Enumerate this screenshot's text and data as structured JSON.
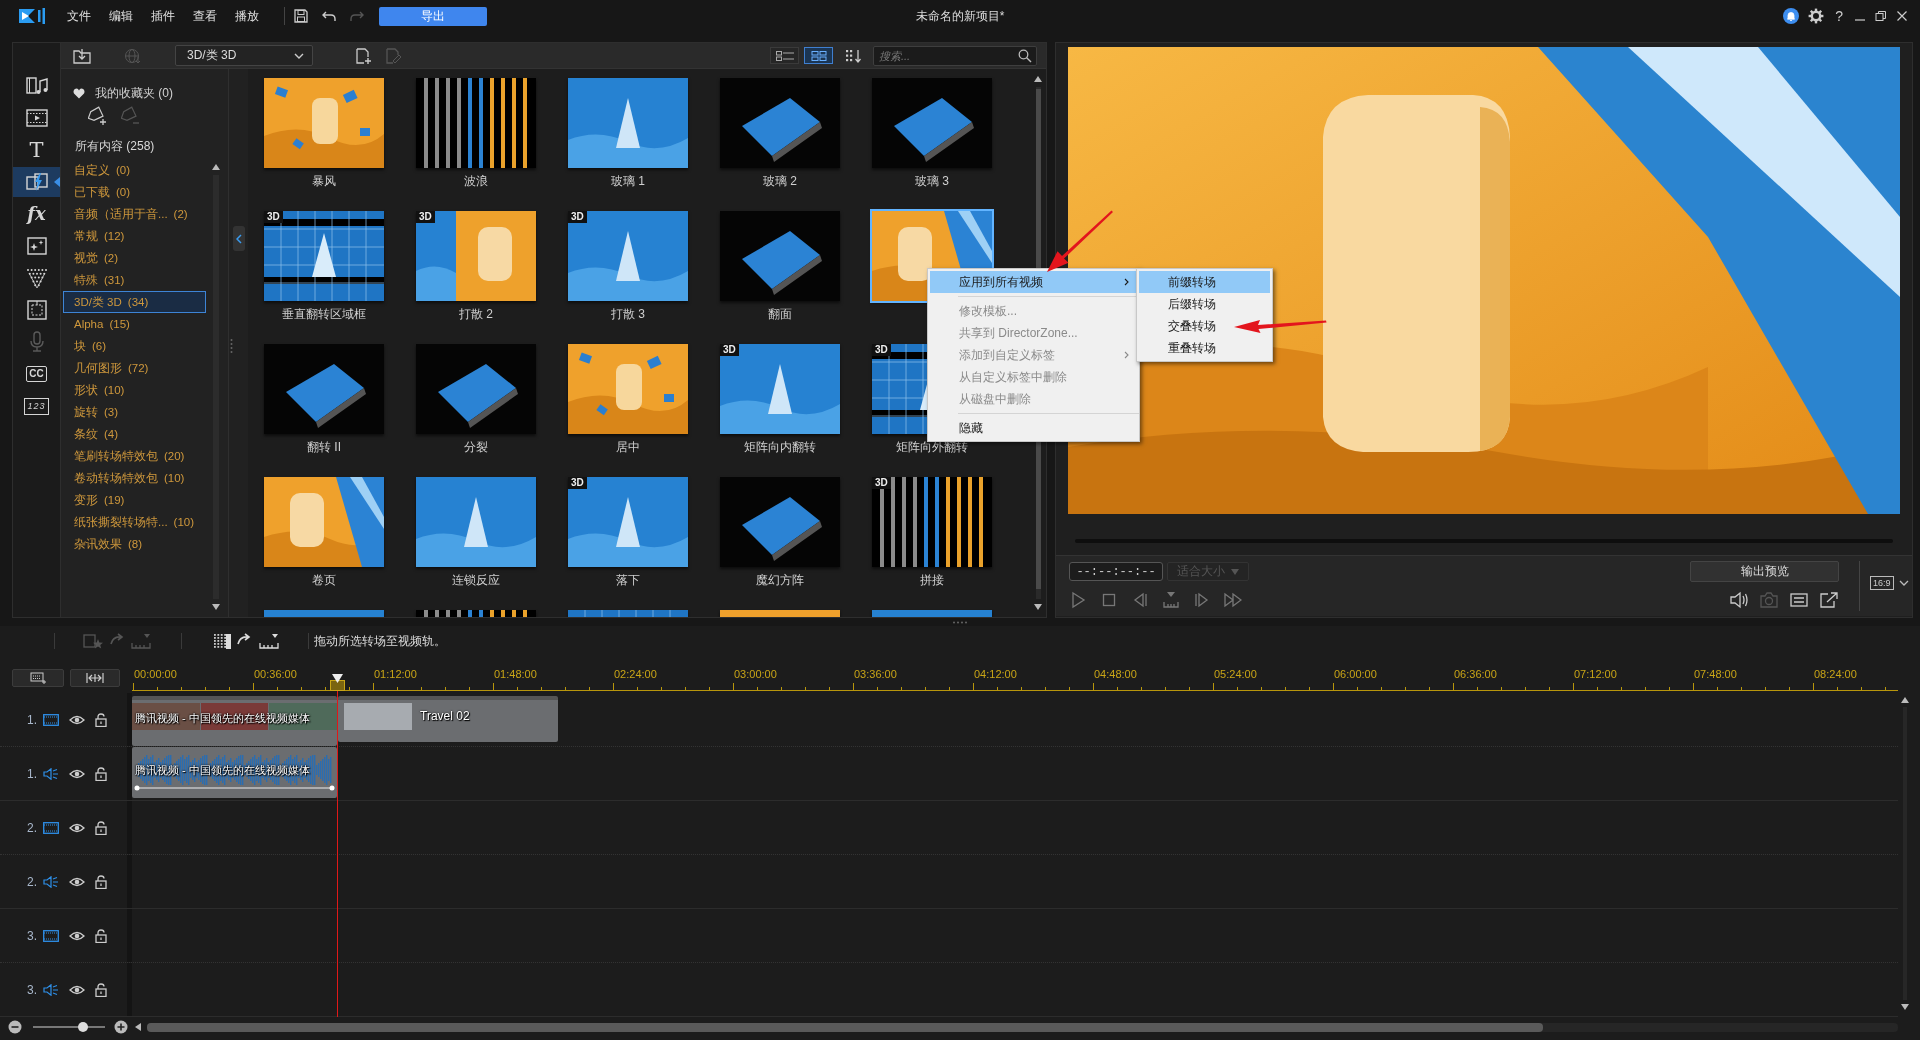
{
  "title_bar": {
    "menus": [
      "文件",
      "编辑",
      "插件",
      "查看",
      "播放"
    ],
    "export_button": "导出",
    "title": "未命名的新项目*",
    "help": "?"
  },
  "side_tools": [
    {
      "kind": "media",
      "selected": false,
      "disabled": false
    },
    {
      "kind": "video",
      "selected": false,
      "disabled": false
    },
    {
      "kind": "title",
      "glyph": "T",
      "selected": false,
      "disabled": false
    },
    {
      "kind": "transition",
      "selected": true,
      "disabled": false
    },
    {
      "kind": "effect",
      "glyph": "fx",
      "selected": false,
      "disabled": false
    },
    {
      "kind": "particle",
      "selected": false,
      "disabled": false
    },
    {
      "kind": "spray",
      "selected": false,
      "disabled": false
    },
    {
      "kind": "chapter",
      "selected": false,
      "disabled": false
    },
    {
      "kind": "voice",
      "selected": false,
      "disabled": true
    },
    {
      "kind": "caption",
      "glyph": "CC",
      "selected": false,
      "disabled": false
    },
    {
      "kind": "counter",
      "glyph": "123",
      "selected": false,
      "disabled": false
    }
  ],
  "library": {
    "category_dropdown": "3D/类 3D",
    "view_modes": [
      {
        "kind": "list",
        "selected": false
      },
      {
        "kind": "grid",
        "selected": true
      }
    ],
    "search": {
      "placeholder": "搜索..."
    },
    "favorites": "我的收藏夹 (0)",
    "all_content": "所有内容 (258)",
    "categories": [
      {
        "name": "自定义",
        "count": "(0)",
        "selected": false
      },
      {
        "name": "已下载",
        "count": "(0)",
        "selected": false
      },
      {
        "name": "音频（适用于音...",
        "count": "(2)",
        "selected": false
      },
      {
        "name": "常规",
        "count": "(12)",
        "selected": false
      },
      {
        "name": "视觉",
        "count": "(2)",
        "selected": false
      },
      {
        "name": "特殊",
        "count": "(31)",
        "selected": false
      },
      {
        "name": "3D/类 3D",
        "count": "(34)",
        "selected": true
      },
      {
        "name": "Alpha",
        "count": "(15)",
        "selected": false
      },
      {
        "name": "块",
        "count": "(6)",
        "selected": false
      },
      {
        "name": "几何图形",
        "count": "(72)",
        "selected": false
      },
      {
        "name": "形状",
        "count": "(10)",
        "selected": false
      },
      {
        "name": "旋转",
        "count": "(3)",
        "selected": false
      },
      {
        "name": "条纹",
        "count": "(4)",
        "selected": false
      },
      {
        "name": "笔刷转场特效包",
        "count": "(20)",
        "selected": false
      },
      {
        "name": "卷动转场特效包",
        "count": "(10)",
        "selected": false
      },
      {
        "name": "变形",
        "count": "(19)",
        "selected": false
      },
      {
        "name": "纸张撕裂转场特...",
        "count": "(10)",
        "selected": false
      },
      {
        "name": "杂讯效果",
        "count": "(8)",
        "selected": false
      }
    ],
    "tile_rows": [
      [
        {
          "label": "暴风",
          "kind": "orange",
          "selected": false
        },
        {
          "label": "波浪",
          "kind": "stripes",
          "selected": false
        },
        {
          "label": "玻璃 1",
          "kind": "blue",
          "selected": false
        },
        {
          "label": "玻璃 2",
          "kind": "dark",
          "selected": false
        },
        {
          "label": "玻璃 3",
          "kind": "dark",
          "selected": false
        }
      ],
      [
        {
          "label": "垂直翻转区域框",
          "kind": "grid",
          "badge": "3D",
          "selected": false
        },
        {
          "label": "打散 2",
          "kind": "split",
          "badge": "3D",
          "selected": false
        },
        {
          "label": "打散 3",
          "kind": "blue",
          "badge": "3D",
          "selected": false
        },
        {
          "label": "翻面",
          "kind": "dark",
          "selected": false
        },
        {
          "kind": "orange_blue",
          "selected": true
        }
      ],
      [
        {
          "label": "翻转 II",
          "kind": "dark",
          "selected": false
        },
        {
          "label": "分裂",
          "kind": "dark",
          "selected": false
        },
        {
          "label": "居中",
          "kind": "orange",
          "selected": false
        },
        {
          "label": "矩阵向内翻转",
          "kind": "blue",
          "badge": "3D",
          "selected": false
        },
        {
          "label": "矩阵向外翻转",
          "kind": "grid",
          "badge": "3D",
          "selected": false
        }
      ],
      [
        {
          "label": "卷页",
          "kind": "orange_blue",
          "selected": false
        },
        {
          "label": "连锁反应",
          "kind": "blue",
          "selected": false
        },
        {
          "label": "落下",
          "kind": "blue",
          "badge": "3D",
          "selected": false
        },
        {
          "label": "魔幻方阵",
          "kind": "dark",
          "selected": false
        },
        {
          "label": "拼接",
          "kind": "stripes",
          "badge": "3D",
          "selected": false
        }
      ],
      [
        {
          "kind": "blue",
          "selected": false
        },
        {
          "kind": "stripes",
          "selected": false
        },
        {
          "kind": "grid",
          "selected": false
        },
        {
          "kind": "orange",
          "selected": false
        },
        {
          "kind": "blue",
          "selected": false
        }
      ]
    ]
  },
  "context_menu": {
    "items": [
      {
        "kind": "item",
        "label": "应用到所有视频",
        "selected": true,
        "disabled": false,
        "has_submenu": true,
        "annotated": true
      },
      {
        "kind": "separator"
      },
      {
        "kind": "item",
        "label": "修改模板...",
        "selected": false,
        "disabled": true,
        "has_submenu": false,
        "annotated": false
      },
      {
        "kind": "item",
        "label": "共享到 DirectorZone...",
        "selected": false,
        "disabled": true,
        "has_submenu": false,
        "annotated": false
      },
      {
        "kind": "item",
        "label": "添加到自定义标签",
        "selected": false,
        "disabled": true,
        "has_submenu": true,
        "annotated": false
      },
      {
        "kind": "item",
        "label": "从自定义标签中删除",
        "selected": false,
        "disabled": true,
        "has_submenu": false,
        "annotated": false
      },
      {
        "kind": "item",
        "label": "从磁盘中删除",
        "selected": false,
        "disabled": true,
        "has_submenu": false,
        "annotated": false
      },
      {
        "kind": "separator"
      },
      {
        "kind": "item",
        "label": "隐藏",
        "selected": false,
        "disabled": false,
        "has_submenu": false,
        "annotated": false
      }
    ],
    "submenu": [
      {
        "label": "前缀转场",
        "selected": true,
        "annotated": false
      },
      {
        "label": "后缀转场",
        "selected": false,
        "annotated": false
      },
      {
        "label": "交叠转场",
        "selected": false,
        "annotated": true
      },
      {
        "label": "重叠转场",
        "selected": false,
        "annotated": false
      }
    ]
  },
  "preview": {
    "timecode": "--:--:--:--",
    "fit": {
      "label": "适合大小",
      "disabled": true
    },
    "output_preview_button": "输出预览",
    "aspect_ratio": "16:9",
    "playback": [
      {
        "kind": "play"
      },
      {
        "kind": "stop"
      },
      {
        "kind": "prev_frame"
      },
      {
        "kind": "mark"
      },
      {
        "kind": "next_frame"
      },
      {
        "kind": "fast_forward"
      }
    ],
    "tools": [
      {
        "kind": "volume",
        "disabled": false
      },
      {
        "kind": "snapshot",
        "disabled": true
      },
      {
        "kind": "list",
        "disabled": false
      },
      {
        "kind": "detach",
        "disabled": false
      }
    ]
  },
  "timeline": {
    "hint": "拖动所选转场至视频轨。",
    "ruler": [
      "00:00:00",
      "00:36:00",
      "01:12:00",
      "01:48:00",
      "02:24:00",
      "03:00:00",
      "03:36:00",
      "04:12:00",
      "04:48:00",
      "05:24:00",
      "06:00:00",
      "06:36:00",
      "07:12:00",
      "07:48:00",
      "08:24:00"
    ],
    "tracks": [
      {
        "number": "1.",
        "kind": "video",
        "visible": true,
        "locked": false,
        "clips": [
          {
            "kind": "video",
            "label": "腾讯视频 - 中国领先的在线视频媒体"
          },
          {
            "kind": "photo",
            "label": "Travel 02"
          }
        ]
      },
      {
        "number": "1.",
        "kind": "audio",
        "visible": true,
        "locked": false,
        "clips": [
          {
            "kind": "audio",
            "label": "腾讯视频 - 中国领先的在线视频媒体"
          }
        ]
      },
      {
        "number": "2.",
        "kind": "video",
        "visible": true,
        "locked": false
      },
      {
        "number": "2.",
        "kind": "audio",
        "visible": true,
        "locked": false
      },
      {
        "number": "3.",
        "kind": "video",
        "visible": true,
        "locked": false
      },
      {
        "number": "3.",
        "kind": "audio",
        "visible": true,
        "locked": false
      }
    ],
    "zoom": {
      "level": 0.69
    }
  }
}
